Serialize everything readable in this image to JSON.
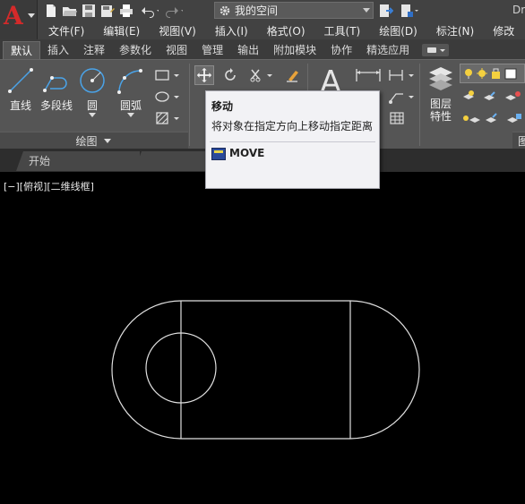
{
  "titlebar": {
    "workspace": "我的空间",
    "title_fragment": "Dr",
    "qat_icons": [
      "new-icon",
      "open-icon",
      "save-icon",
      "save-as-icon",
      "print-icon",
      "undo-icon",
      "redo-icon"
    ]
  },
  "menu": {
    "items": [
      "文件(F)",
      "编辑(E)",
      "视图(V)",
      "插入(I)",
      "格式(O)",
      "工具(T)",
      "绘图(D)",
      "标注(N)",
      "修改"
    ]
  },
  "ribbon_tabs": {
    "items": [
      "默认",
      "插入",
      "注释",
      "参数化",
      "视图",
      "管理",
      "输出",
      "附加模块",
      "协作",
      "精选应用"
    ],
    "active": "默认"
  },
  "ribbon": {
    "draw": {
      "line": "直线",
      "polyline": "多段线",
      "circle": "圆",
      "arc": "圆弧",
      "panel_title": "绘图"
    },
    "annotation": {
      "text_glyph": "A"
    },
    "layers": {
      "layer_props": "图层\n特性",
      "layer_props_line1": "图层",
      "layer_props_line2": "特性",
      "panel_title_fragment": "图"
    }
  },
  "filetabs": {
    "start": "开始"
  },
  "canvas": {
    "viewport_label": "[−][俯视][二维线框]"
  },
  "tooltip": {
    "title": "移动",
    "description": "将对象在指定方向上移动指定距离",
    "command": "MOVE"
  },
  "colors": {
    "accent_red": "#d42a2a",
    "ribbon_bg": "#555555",
    "canvas_bg": "#000000",
    "line_color": "#e0e0e0"
  }
}
